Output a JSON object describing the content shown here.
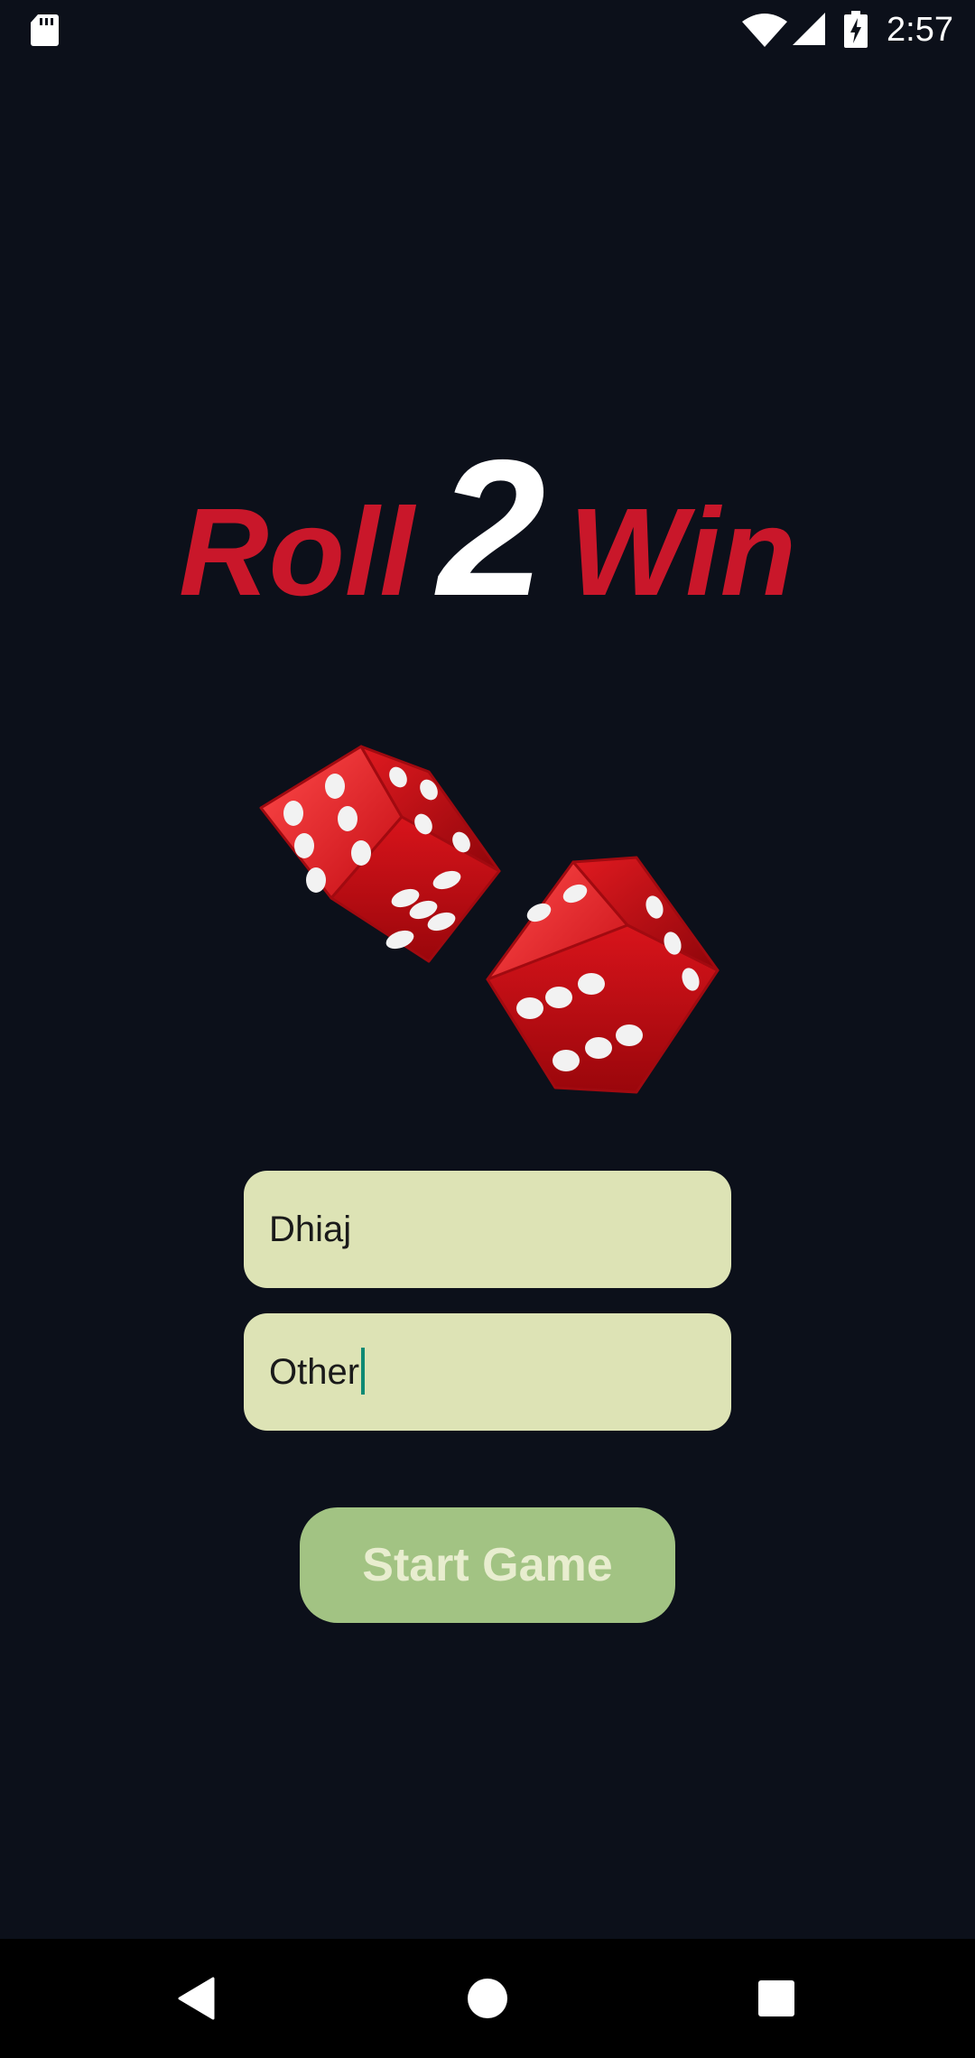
{
  "status_bar": {
    "time": "2:57",
    "icons": [
      "sd-card-icon",
      "wifi-icon",
      "signal-icon",
      "battery-charging-icon"
    ]
  },
  "title": {
    "part1": "Roll",
    "part2": "2",
    "part3": "Win"
  },
  "inputs": {
    "player1": "Dhiaj",
    "player2": "Other"
  },
  "start_button": {
    "label": "Start Game"
  },
  "nav_bar": {
    "icons": [
      "back-icon",
      "home-icon",
      "recents-icon"
    ]
  },
  "colors": {
    "background": "#0c101a",
    "title_red": "#c9172a",
    "title_number": "#ffffff",
    "input_bg": "#dde3b5",
    "button_bg": "#a2c383",
    "button_text": "#e8edcf",
    "caret": "#0f8a74"
  }
}
